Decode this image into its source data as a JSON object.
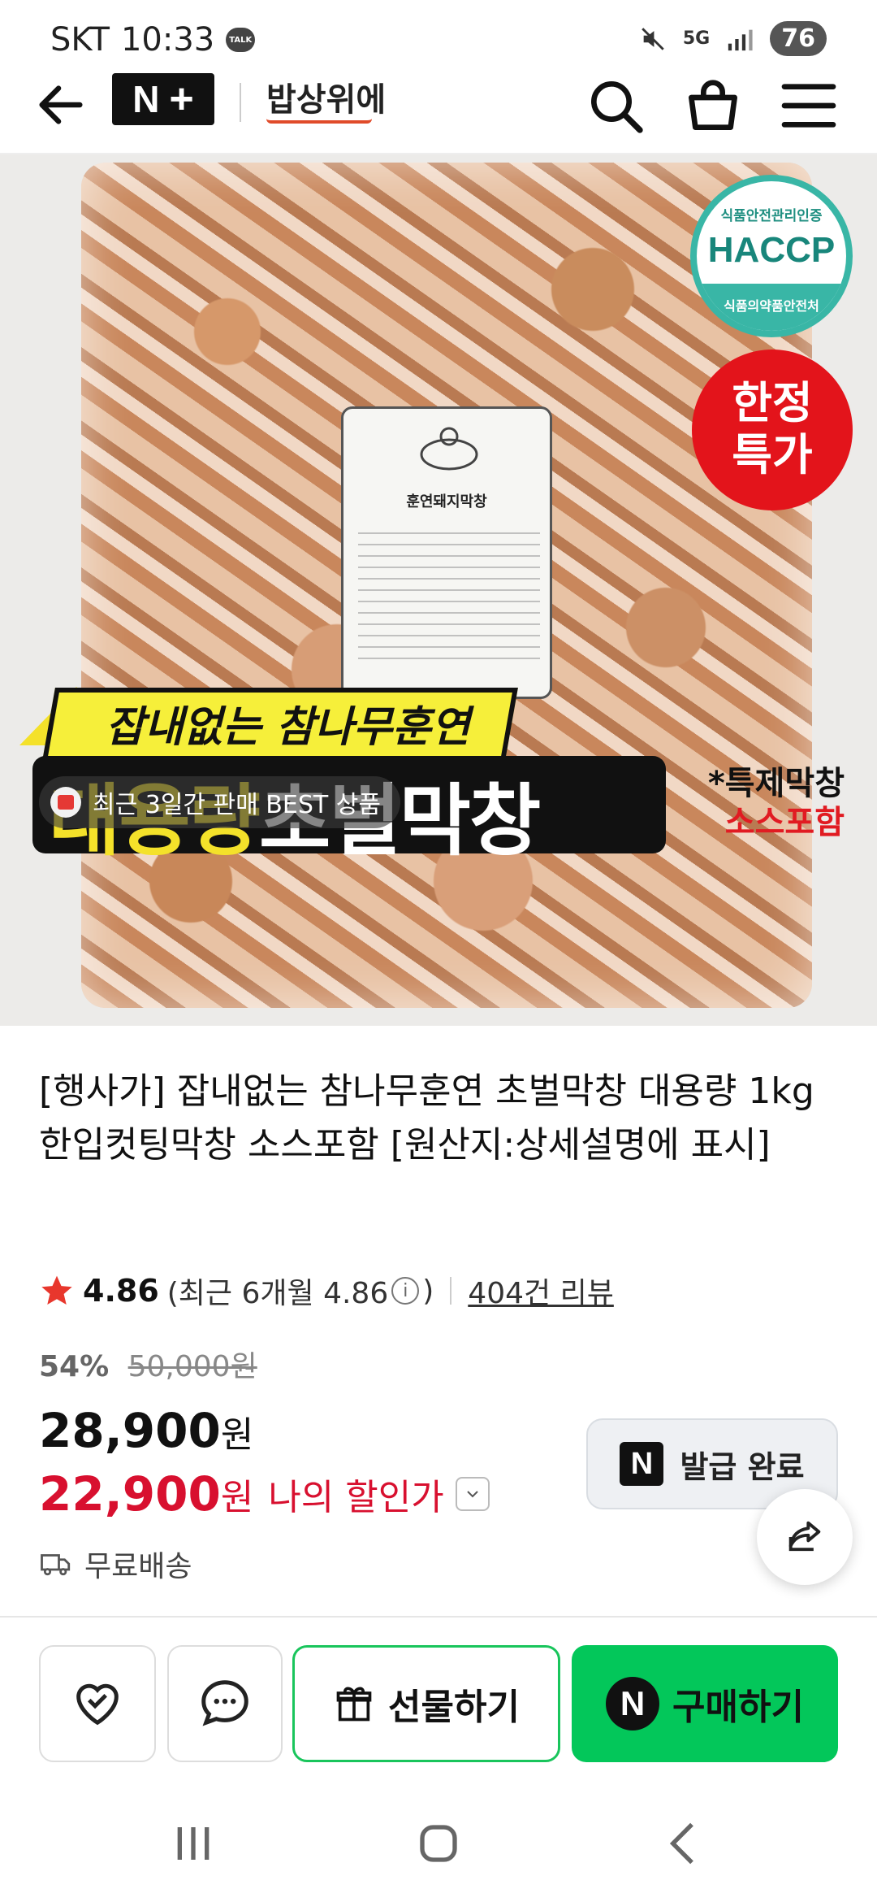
{
  "status_bar": {
    "carrier": "SKT",
    "time": "10:33",
    "talk": "TALK",
    "network": "5G",
    "battery": "76"
  },
  "header": {
    "brand_logo": "N+",
    "brand_name": "밥상위에"
  },
  "hero": {
    "haccp_top": "식품안전관리인증",
    "haccp_mid": "HACCP",
    "haccp_bottom": "식품의약품안전처",
    "limited_line1": "한정",
    "limited_line2": "특가",
    "label_title": "훈연돼지막창",
    "banner_top": "잡내없는 참나무훈연",
    "banner_big_a": "대용량",
    "banner_big_b": "초벌막창",
    "note_a": "*특제막창",
    "note_b": "소스포함",
    "best_badge": "최근 3일간 판매 BEST 상품"
  },
  "product": {
    "title": "[행사가] 잡내없는 참나무훈연 초벌막창 대용량 1kg 한입컷팅막창 소스포함 [원산지:상세설명에 표시]",
    "rating": "4.86",
    "rating_recent_a": "(최근 6개월 4.86",
    "rating_recent_b": ")",
    "reviews": "404건 리뷰",
    "discount_pct": "54%",
    "original_price": "50,000원",
    "price": "28,900",
    "price_unit": "원",
    "my_price": "22,900",
    "my_price_unit": "원",
    "my_price_label": "나의 할인가",
    "coupon_label": "발급 완료",
    "shipping": "무료배송"
  },
  "bottom_bar": {
    "gift": "선물하기",
    "buy": "구매하기"
  },
  "colors": {
    "accent_green": "#03c75a",
    "sale_red": "#d8102f",
    "haccp_teal": "#39b6a6"
  }
}
